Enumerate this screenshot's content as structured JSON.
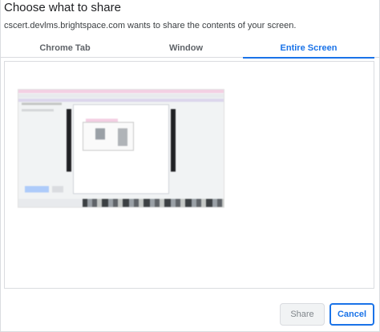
{
  "dialog": {
    "title": "Choose what to share",
    "subtitle": "cscert.devlms.brightspace.com wants to share the contents of your screen."
  },
  "tabs": [
    {
      "label": "Chrome Tab",
      "selected": false
    },
    {
      "label": "Window",
      "selected": false
    },
    {
      "label": "Entire Screen",
      "selected": true
    }
  ],
  "buttons": {
    "share_label": "Share",
    "share_enabled": false,
    "cancel_label": "Cancel"
  },
  "colors": {
    "accent": "#1a73e8",
    "border": "#dadce0",
    "text": "#202124"
  }
}
